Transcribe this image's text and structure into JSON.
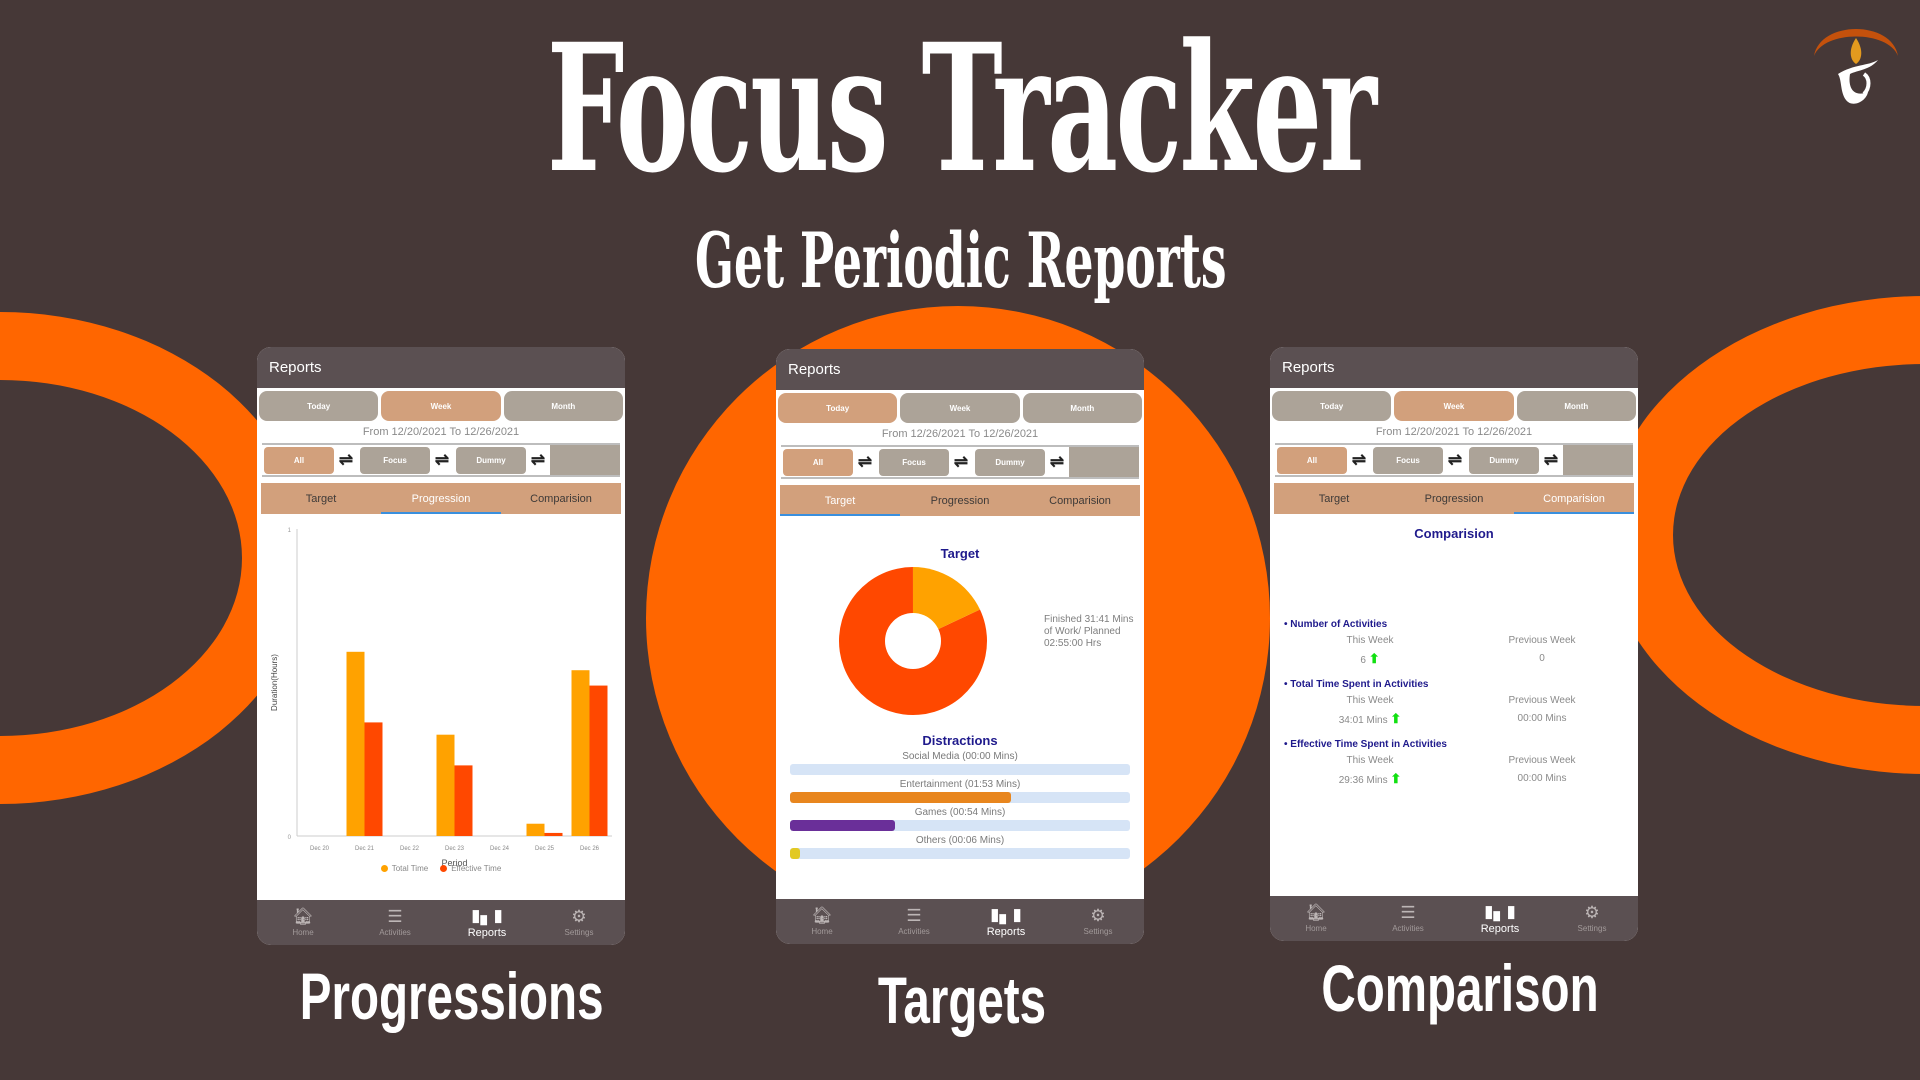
{
  "banner": {
    "title": "Focus Tracker",
    "subtitle": "Get Periodic Reports",
    "logo_icon": "candle-flame-logo-icon"
  },
  "colors": {
    "background": "#463837",
    "accent_orange": "#ff6600",
    "app_bar": "#5b5052",
    "active_tab": "#d2a07c",
    "inactive_tab": "#aca398",
    "tab_indicator": "#3a8fdd",
    "heading_blue": "#1f1a8c",
    "total_time": "#ffa200",
    "effective_time": "#ff4800",
    "up_arrow": "#11e011"
  },
  "captions": [
    "Progressions",
    "Targets",
    "Comparison"
  ],
  "screens": [
    {
      "app_title": "Reports",
      "periods": [
        {
          "label": "Today",
          "active": false
        },
        {
          "label": "Week",
          "active": true
        },
        {
          "label": "Month",
          "active": false
        }
      ],
      "date_range": "From 12/20/2021 To 12/26/2021",
      "filters": [
        {
          "label": "All",
          "active": true
        },
        {
          "label": "Focus",
          "active": false
        },
        {
          "label": "Dummy",
          "active": false
        }
      ],
      "tabs": [
        {
          "label": "Target",
          "active": false
        },
        {
          "label": "Progression",
          "active": true
        },
        {
          "label": "Comparision",
          "active": false
        }
      ],
      "nav": [
        {
          "label": "Home",
          "icon": "home-icon",
          "active": false
        },
        {
          "label": "Activities",
          "icon": "list-icon",
          "active": false
        },
        {
          "label": "Reports",
          "icon": "bar-chart-icon",
          "active": true
        },
        {
          "label": "Settings",
          "icon": "gear-icon",
          "active": false
        }
      ]
    },
    {
      "app_title": "Reports",
      "periods": [
        {
          "label": "Today",
          "active": true
        },
        {
          "label": "Week",
          "active": false
        },
        {
          "label": "Month",
          "active": false
        }
      ],
      "date_range": "From 12/26/2021 To 12/26/2021",
      "filters": [
        {
          "label": "All",
          "active": true
        },
        {
          "label": "Focus",
          "active": false
        },
        {
          "label": "Dummy",
          "active": false
        }
      ],
      "tabs": [
        {
          "label": "Target",
          "active": true
        },
        {
          "label": "Progression",
          "active": false
        },
        {
          "label": "Comparision",
          "active": false
        }
      ],
      "target": {
        "title": "Target",
        "finished_fraction": 0.18,
        "note": "Finished 31:41 Mins of Work/ Planned 02:55:00 Hrs",
        "finished_color": "#ffa200",
        "remaining_color": "#ff4800"
      },
      "distractions": {
        "title": "Distractions",
        "items": [
          {
            "label": "Social Media (00:00 Mins)",
            "fraction": 0.0,
            "color": "#e58a1f"
          },
          {
            "label": "Entertainment (01:53 Mins)",
            "fraction": 0.65,
            "color": "#e8861e"
          },
          {
            "label": "Games (00:54 Mins)",
            "fraction": 0.31,
            "color": "#6a2f99"
          },
          {
            "label": "Others (00:06 Mins)",
            "fraction": 0.03,
            "color": "#e2c924"
          }
        ]
      },
      "nav": [
        {
          "label": "Home",
          "icon": "home-icon",
          "active": false
        },
        {
          "label": "Activities",
          "icon": "list-icon",
          "active": false
        },
        {
          "label": "Reports",
          "icon": "bar-chart-icon",
          "active": true
        },
        {
          "label": "Settings",
          "icon": "gear-icon",
          "active": false
        }
      ]
    },
    {
      "app_title": "Reports",
      "periods": [
        {
          "label": "Today",
          "active": false
        },
        {
          "label": "Week",
          "active": true
        },
        {
          "label": "Month",
          "active": false
        }
      ],
      "date_range": "From 12/20/2021 To 12/26/2021",
      "filters": [
        {
          "label": "All",
          "active": true
        },
        {
          "label": "Focus",
          "active": false
        },
        {
          "label": "Dummy",
          "active": false
        }
      ],
      "tabs": [
        {
          "label": "Target",
          "active": false
        },
        {
          "label": "Progression",
          "active": false
        },
        {
          "label": "Comparision",
          "active": true
        }
      ],
      "comparison": {
        "title": "Comparision",
        "sections": [
          {
            "heading": "Number of Activities",
            "this_label": "This Week",
            "prev_label": "Previous Week",
            "this_value": "6",
            "prev_value": "0",
            "trend": "up"
          },
          {
            "heading": "Total Time Spent in Activities",
            "this_label": "This Week",
            "prev_label": "Previous Week",
            "this_value": "34:01 Mins",
            "prev_value": "00:00 Mins",
            "trend": "up"
          },
          {
            "heading": "Effective Time Spent in Activities",
            "this_label": "This Week",
            "prev_label": "Previous Week",
            "this_value": "29:36 Mins",
            "prev_value": "00:00 Mins",
            "trend": "up"
          }
        ]
      },
      "nav": [
        {
          "label": "Home",
          "icon": "home-icon",
          "active": false
        },
        {
          "label": "Activities",
          "icon": "list-icon",
          "active": false
        },
        {
          "label": "Reports",
          "icon": "bar-chart-icon",
          "active": true
        },
        {
          "label": "Settings",
          "icon": "gear-icon",
          "active": false
        }
      ]
    }
  ],
  "chart_data": {
    "type": "bar",
    "title": "",
    "xlabel": "Period",
    "ylabel": "Duration(Hours)",
    "categories": [
      "Dec 20",
      "Dec 21",
      "Dec 22",
      "Dec 23",
      "Dec 24",
      "Dec 25",
      "Dec 26"
    ],
    "series": [
      {
        "name": "Total Time",
        "color": "#ffa200",
        "values": [
          0,
          0.6,
          0,
          0.33,
          0,
          0.04,
          0.54
        ]
      },
      {
        "name": "Effective Time",
        "color": "#ff4800",
        "values": [
          0,
          0.37,
          0,
          0.23,
          0,
          0.01,
          0.49
        ]
      }
    ],
    "ylim": [
      0,
      1
    ],
    "yticks": [
      "0",
      "1"
    ],
    "grid": false,
    "legend": "bottom"
  }
}
